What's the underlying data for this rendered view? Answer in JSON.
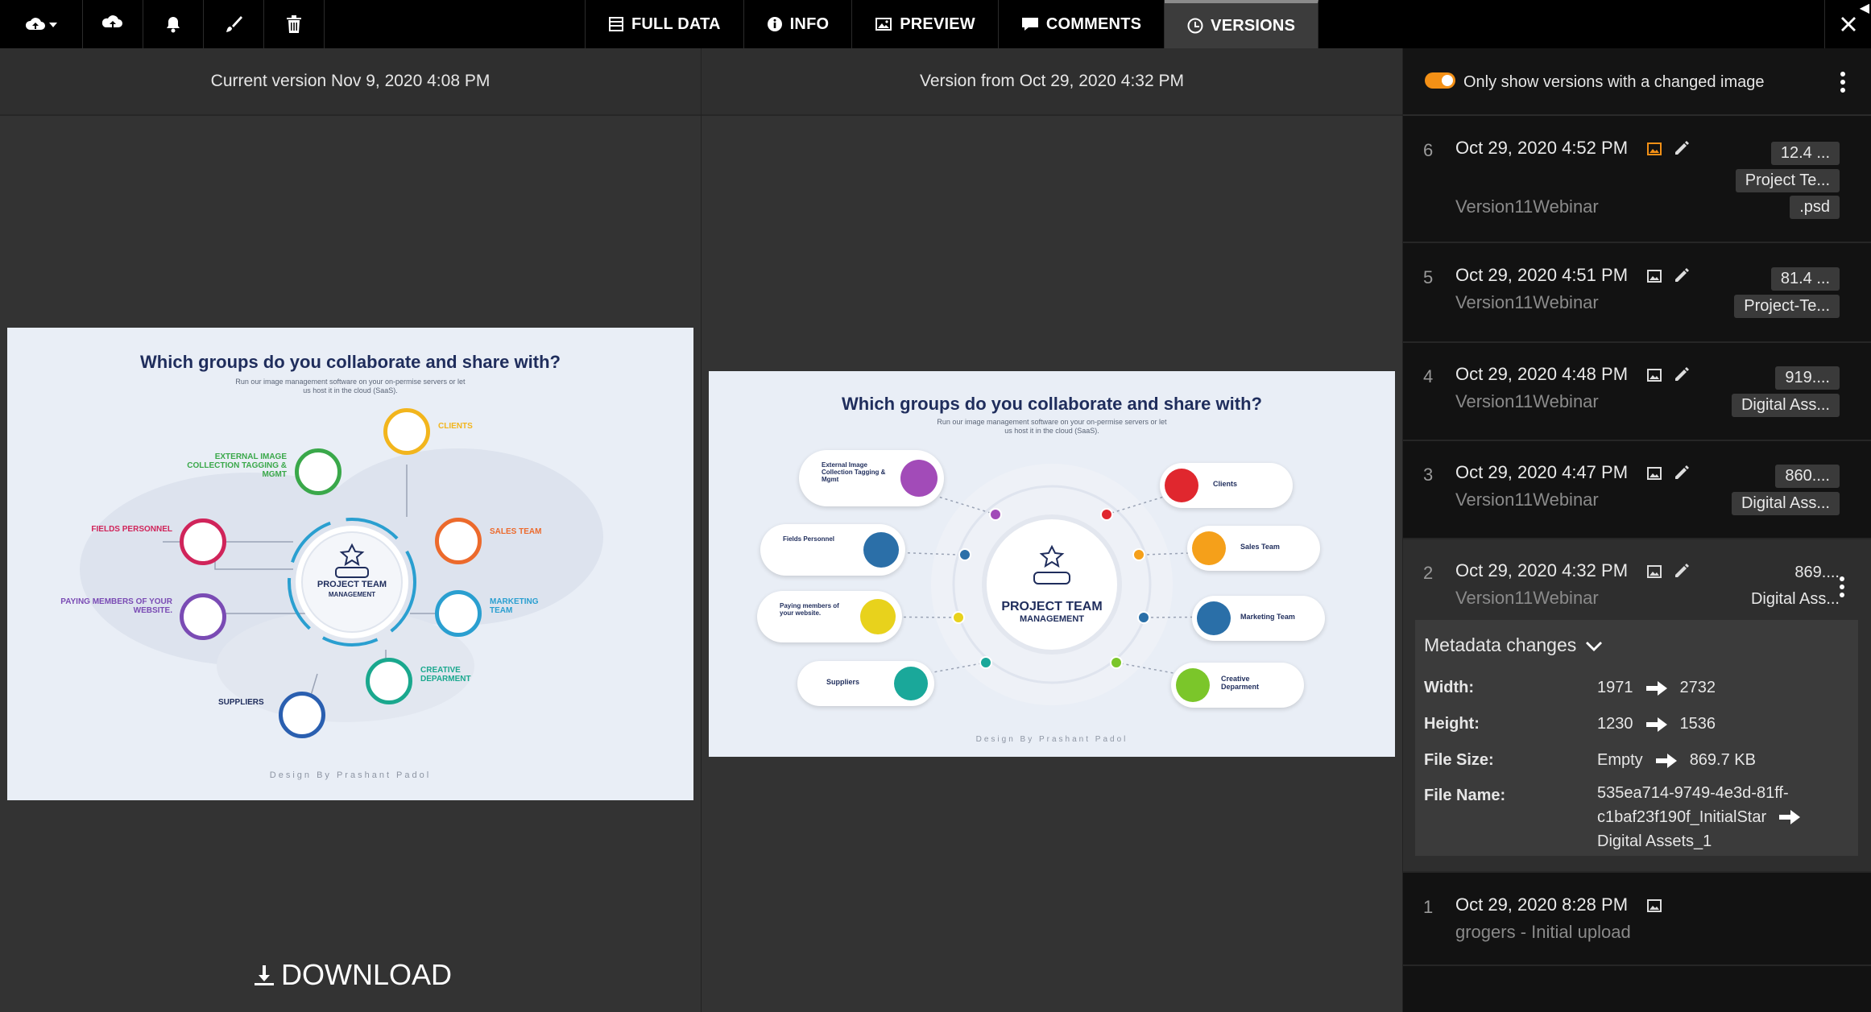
{
  "toolbar": {
    "icons": [
      "cloud-upload-menu-icon",
      "cloud-sync-icon",
      "bell-icon",
      "brush-icon",
      "trash-icon"
    ],
    "tabs": [
      {
        "label": "FULL DATA",
        "icon": "table-icon"
      },
      {
        "label": "INFO",
        "icon": "info-icon"
      },
      {
        "label": "PREVIEW",
        "icon": "image-icon"
      },
      {
        "label": "COMMENTS",
        "icon": "comment-icon"
      },
      {
        "label": "VERSIONS",
        "icon": "clock-icon",
        "active": true
      }
    ],
    "close_icon": "close-icon"
  },
  "left_pane": {
    "header": "Current version Nov 9, 2020 4:08 PM",
    "download_label": "DOWNLOAD",
    "infographic": {
      "title": "Which groups do you collaborate and share with?",
      "subtitle_line1": "Run our image management software on your on-permise servers or let",
      "subtitle_line2": "us host it in the cloud (SaaS).",
      "center_line1": "PROJECT TEAM",
      "center_line2": "MANAGEMENT",
      "footer": "Design By Prashant Padol",
      "nodes": [
        {
          "label": "CLIENTS",
          "color": "#f2b51d"
        },
        {
          "label": "SALES TEAM",
          "color": "#ec6a2c"
        },
        {
          "label": "MARKETING TEAM",
          "color": "#2a9fd0"
        },
        {
          "label": "CREATIVE DEPARMENT",
          "color": "#1aa88e"
        },
        {
          "label": "SUPPLIERS",
          "color": "#2a5fb0"
        },
        {
          "label": "PAYING MEMBERS OF YOUR WEBSITE.",
          "color": "#7a4bb4"
        },
        {
          "label": "FIELDS PERSONNEL",
          "color": "#d0245a"
        },
        {
          "label": "EXTERNAL IMAGE COLLECTION TAGGING & MGMT",
          "color": "#3aa84a"
        }
      ]
    }
  },
  "mid_pane": {
    "header": "Version from Oct 29, 2020 4:32 PM",
    "infographic": {
      "title": "Which groups do you collaborate and share with?",
      "subtitle_line1": "Run our image management software on your on-permise servers or let",
      "subtitle_line2": "us host it in the cloud (SaaS).",
      "center_line1": "PROJECT TEAM",
      "center_line2": "MANAGEMENT",
      "footer": "Design By Prashant Padol",
      "nodes": [
        {
          "label": "External Image Collection Tagging & Mgmt",
          "color": "#a24bb8"
        },
        {
          "label": "Fields Personnel",
          "color": "#2b6fa8"
        },
        {
          "label": "Paying members of your website.",
          "color": "#e8d21c"
        },
        {
          "label": "Suppliers",
          "color": "#1aa89a"
        },
        {
          "label": "Clients",
          "color": "#e0272e"
        },
        {
          "label": "Sales Team",
          "color": "#f5a01a"
        },
        {
          "label": "Marketing Team",
          "color": "#2a6fa8"
        },
        {
          "label": "Creative Deparment",
          "color": "#7bc62a"
        }
      ]
    }
  },
  "sidebar": {
    "filter_label": "Only show versions with a changed image",
    "filter_on": true,
    "versions": [
      {
        "num": "6",
        "date": "Oct 29, 2020 4:52 PM",
        "author": "Version11Webinar",
        "chips": [
          "12.4 ...",
          "Project Te...",
          ".psd"
        ],
        "thumb_color": "#f39016"
      },
      {
        "num": "5",
        "date": "Oct 29, 2020 4:51 PM",
        "author": "Version11Webinar",
        "chips": [
          "81.4 ...",
          "Project-Te..."
        ]
      },
      {
        "num": "4",
        "date": "Oct 29, 2020 4:48 PM",
        "author": "Version11Webinar",
        "chips": [
          "919....",
          "Digital Ass..."
        ]
      },
      {
        "num": "3",
        "date": "Oct 29, 2020 4:47 PM",
        "author": "Version11Webinar",
        "chips": [
          "860....",
          "Digital Ass..."
        ]
      },
      {
        "num": "2",
        "date": "Oct 29, 2020 4:32 PM",
        "author": "Version11Webinar",
        "chips": [
          "869....",
          "Digital Ass..."
        ]
      },
      {
        "num": "1",
        "date": "Oct 29, 2020 8:28 PM",
        "author": "grogers - Initial upload",
        "chips": []
      }
    ],
    "metadata": {
      "heading": "Metadata changes",
      "rows": [
        {
          "label": "Width:",
          "from": "1971",
          "to": "2732"
        },
        {
          "label": "Height:",
          "from": "1230",
          "to": "1536"
        },
        {
          "label": "File Size:",
          "from": "Empty",
          "to": "869.7 KB"
        }
      ],
      "file_name_label": "File Name:",
      "file_name_from_line1": "535ea714-9749-4e3d-81ff-",
      "file_name_from_line2": "c1baf23f190f_InitialStar",
      "file_name_to": "Digital Assets_1"
    }
  }
}
